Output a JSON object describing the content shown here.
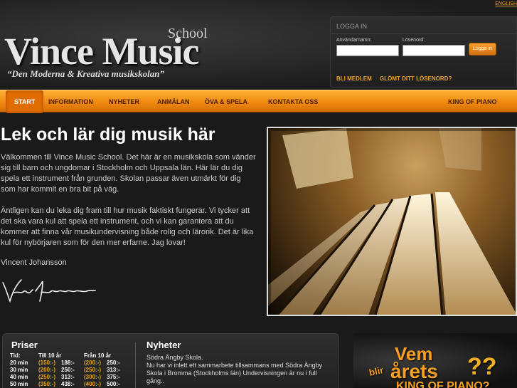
{
  "header": {
    "english_link": "ENGLISH",
    "logo": {
      "school": "School",
      "name": "Vince Music",
      "tagline": "“Den Moderna & Kreativa musikskolan”"
    }
  },
  "login": {
    "title": "LOGGA IN",
    "username_label": "Användarnamn:",
    "password_label": "Lösenord:",
    "username_value": "",
    "password_value": "",
    "button": "Logga in",
    "become_member": "BLI MEDLEM",
    "forgot_password": "GLÖMT DITT LÖSENORD?"
  },
  "nav": {
    "items": [
      {
        "label": "START",
        "active": true
      },
      {
        "label": "INFORMATION"
      },
      {
        "label": "NYHETER"
      },
      {
        "label": "ANMÄLAN"
      },
      {
        "label": "ÖVA & SPELA"
      },
      {
        "label": "KONTAKTA OSS"
      },
      {
        "label": "KING OF PIANO"
      }
    ]
  },
  "main": {
    "headline": "Lek och lär dig musik här",
    "paragraph1": "Välkommen till Vince Music School. Det här är en musikskola som vänder sig till barn och ungdomar i Stockholm och Uppsala län. Här lär du dig spela ett instrument från grunden. Skolan passar även utmärkt för dig som har kommit en bra bit på väg.",
    "paragraph2": "Äntligen kan du leka dig fram till hur musik faktiskt fungerar. Vi tycker att det ska vara kul att spela ett instrument, och vi kan garantera att du kommer att finna vår musikundervisning både rolig och lärorik. Det är lika kul för nybörjaren som för den mer erfarne. Jag lovar!",
    "author": "Vincent Johansson",
    "signature_text": "Vincent Johansson"
  },
  "prices": {
    "title": "Priser",
    "col_time": "Tid:",
    "col_under10": "Till 10 år",
    "col_over10": "Från 10 år",
    "rows": [
      {
        "time": "20 min",
        "u_paren": "(150:-)",
        "u": "188:-",
        "o_paren": "(200:-)",
        "o": "250:-"
      },
      {
        "time": "30 min",
        "u_paren": "(200:-)",
        "u": "250:-",
        "o_paren": "(250:-)",
        "o": "313:-"
      },
      {
        "time": "40 min",
        "u_paren": "(250:-)",
        "u": "313:-",
        "o_paren": "(300:-)",
        "o": "375:-"
      },
      {
        "time": "50 min",
        "u_paren": "(350:-)",
        "u": "438:-",
        "o_paren": "(400:-)",
        "o": "500:-"
      }
    ]
  },
  "news": {
    "title": "Nyheter",
    "headline": "Södra Ängby Skola.",
    "body": "Nu har vi inlett ett sammarbete tillsammans med Södra Ängby Skola i Bromma (Stockholms län) Undervisningen är nu i full gång.."
  },
  "ad": {
    "line1": "Vem",
    "line2": "blir",
    "line3": "årets",
    "line4": "KING OF PIANO?",
    "marks": "??"
  },
  "colors": {
    "accent": "#f08a10",
    "link": "#e8a020"
  }
}
